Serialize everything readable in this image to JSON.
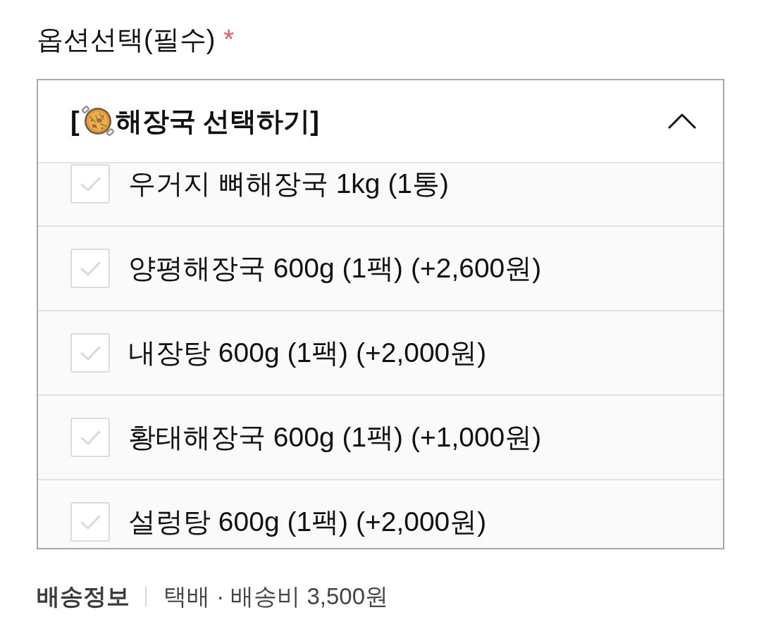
{
  "field": {
    "label": "옵션선택(필수)",
    "required_mark": "*"
  },
  "dropdown": {
    "title_start": "[",
    "title_end": "해장국 선택하기]",
    "expanded": true,
    "options": [
      {
        "label": "우거지 뼈해장국 1kg (1통)",
        "checked": false
      },
      {
        "label": "양평해장국 600g (1팩) (+2,600원)",
        "checked": false
      },
      {
        "label": "내장탕 600g (1팩) (+2,000원)",
        "checked": false
      },
      {
        "label": "황태해장국 600g (1팩) (+1,000원)",
        "checked": false
      },
      {
        "label": "설렁탕 600g (1팩) (+2,000원)",
        "checked": false
      }
    ]
  },
  "shipping": {
    "label": "배송정보",
    "value": "택배 · 배송비 3,500원"
  }
}
